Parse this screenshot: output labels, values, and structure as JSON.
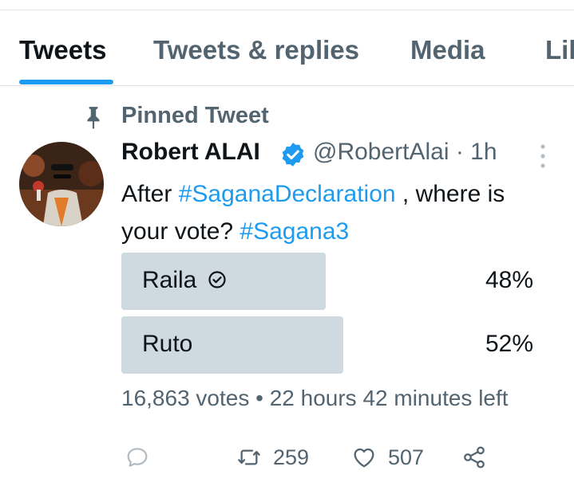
{
  "tabs": [
    {
      "label": "Tweets",
      "active": true
    },
    {
      "label": "Tweets & replies",
      "active": false
    },
    {
      "label": "Media",
      "active": false
    },
    {
      "label": "Lik",
      "active": false
    }
  ],
  "pinned": {
    "label": "Pinned Tweet",
    "icon": "pin-icon"
  },
  "tweet": {
    "author_name": "Robert ALAI",
    "handle_time": "@RobertAlai · 1h",
    "text_part1": "After ",
    "hashtag1": "#SaganaDeclaration",
    "text_part2": " , where is your vote? ",
    "hashtag2": "#Sagana3",
    "verified_color": "#1d9bf0"
  },
  "poll": {
    "options": [
      {
        "label": "Raila",
        "percent": 48,
        "percent_text": "48%",
        "selected": true
      },
      {
        "label": "Ruto",
        "percent": 52,
        "percent_text": "52%",
        "selected": false
      }
    ],
    "meta": "16,863 votes • 22 hours 42 minutes left"
  },
  "actions": {
    "reply_count": "",
    "retweet_count": "259",
    "like_count": "507"
  },
  "colors": {
    "accent": "#1d9bf0",
    "muted": "#536471",
    "poll_bar": "#cfd9e0"
  }
}
